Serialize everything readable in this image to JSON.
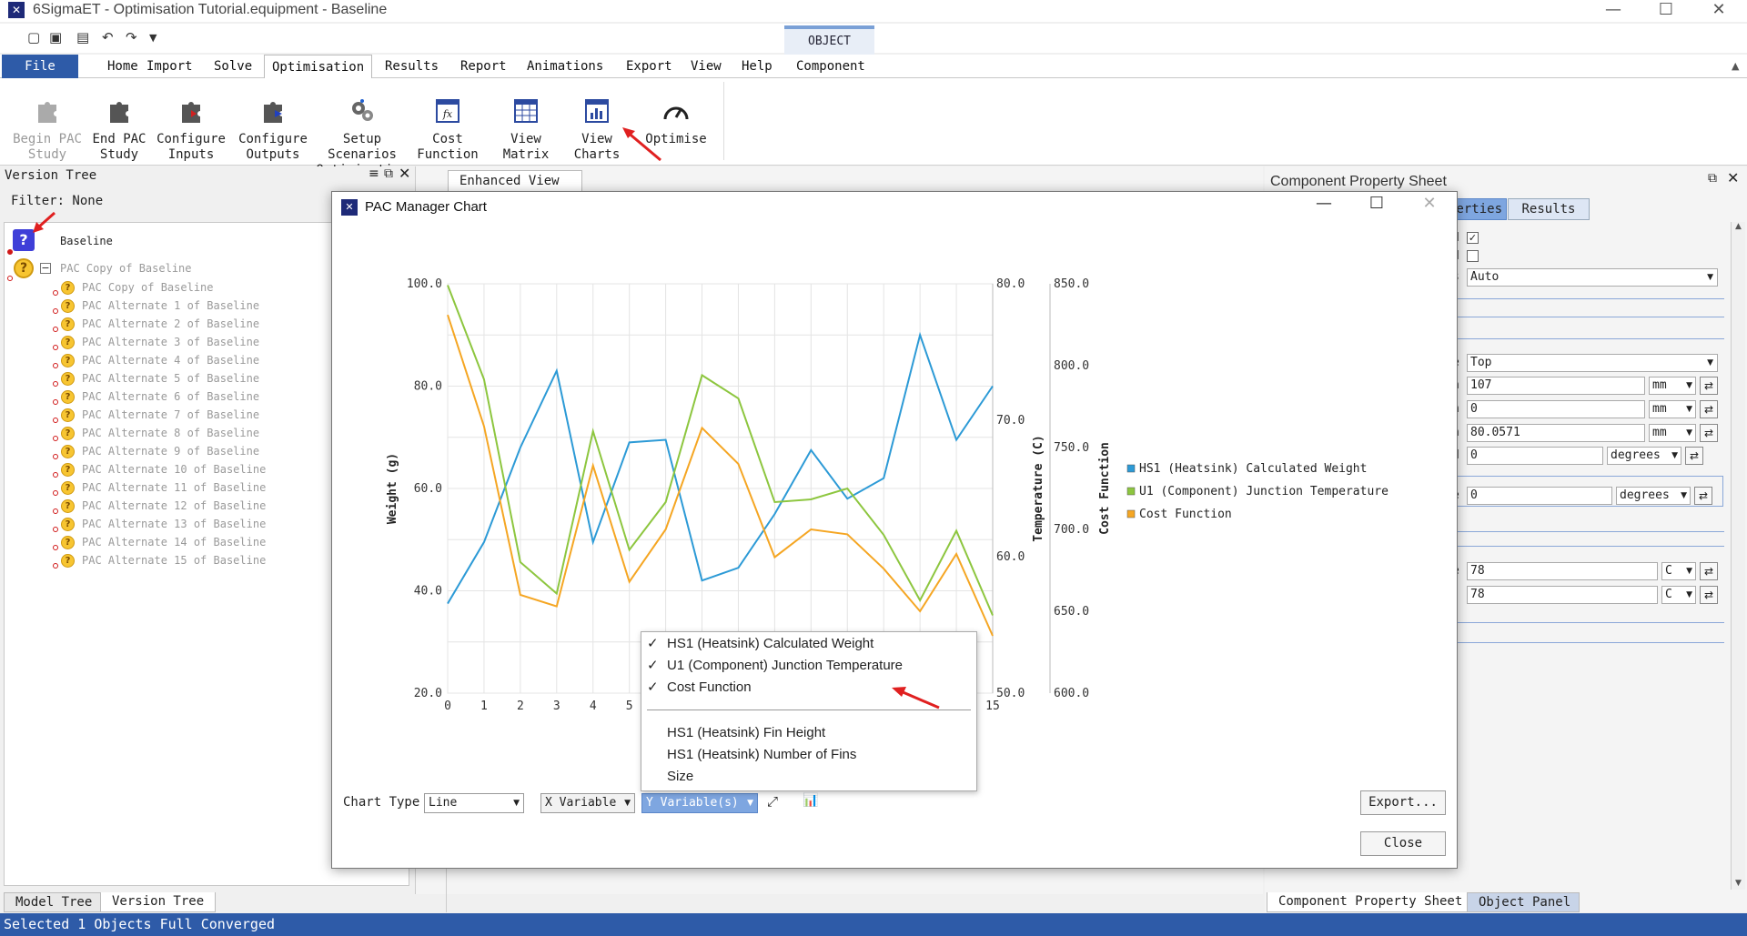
{
  "window": {
    "title": "6SigmaET - Optimisation Tutorial.equipment - Baseline",
    "minimize": "—",
    "maximize": "☐",
    "close": "✕"
  },
  "context_tab": {
    "group": "OBJECT",
    "label": "Component"
  },
  "menu": [
    "File",
    "Home",
    "Import",
    "Solve",
    "Optimisation",
    "Results",
    "Report",
    "Animations",
    "Export",
    "View",
    "Help"
  ],
  "ribbon": {
    "buttons": [
      {
        "label": "Begin PAC\nStudy",
        "icon": "puzzle-icon",
        "enabled": false
      },
      {
        "label": "End PAC\nStudy",
        "icon": "puzzle-icon",
        "enabled": true
      },
      {
        "label": "Configure\nInputs",
        "icon": "puzzle-input-icon",
        "enabled": true
      },
      {
        "label": "Configure\nOutputs",
        "icon": "puzzle-output-icon",
        "enabled": true
      },
      {
        "label": "Setup\nScenarios\nOptimisation",
        "icon": "gears-icon",
        "enabled": true
      },
      {
        "label": "Cost\nFunction",
        "icon": "fx-icon",
        "enabled": true
      },
      {
        "label": "View\nMatrix",
        "icon": "table-icon",
        "enabled": true
      },
      {
        "label": "View\nCharts",
        "icon": "bar-chart-icon",
        "enabled": true
      },
      {
        "label": "Optimise",
        "icon": "gauge-icon",
        "enabled": true
      }
    ]
  },
  "version_tree": {
    "title": "Version Tree",
    "filter": "Filter: None",
    "root": "Baseline",
    "copy_parent": "PAC Copy of Baseline",
    "items": [
      "PAC Copy of Baseline",
      "PAC Alternate 1 of Baseline",
      "PAC Alternate 2 of Baseline",
      "PAC Alternate 3 of Baseline",
      "PAC Alternate 4 of Baseline",
      "PAC Alternate 5 of Baseline",
      "PAC Alternate 6 of Baseline",
      "PAC Alternate 7 of Baseline",
      "PAC Alternate 8 of Baseline",
      "PAC Alternate 9 of Baseline",
      "PAC Alternate 10 of Baseline",
      "PAC Alternate 11 of Baseline",
      "PAC Alternate 12 of Baseline",
      "PAC Alternate 13 of Baseline",
      "PAC Alternate 14 of Baseline",
      "PAC Alternate 15 of Baseline"
    ]
  },
  "bottom_tabs_left": [
    "Model Tree",
    "Version Tree"
  ],
  "status": "Selected 1 Objects Full Converged",
  "center": {
    "tab": "Enhanced View"
  },
  "property_sheet": {
    "title": "Component Property Sheet",
    "tabs": [
      "erties",
      "Results"
    ],
    "rows": [
      {
        "label": "d",
        "type": "check",
        "checked": true
      },
      {
        "label": "d",
        "type": "check",
        "checked": false
      },
      {
        "label": "s",
        "type": "select",
        "value": "Auto"
      },
      {
        "label": "e",
        "type": "select",
        "value": "Top"
      },
      {
        "label": "n",
        "type": "unit",
        "value": "107",
        "unit": "mm"
      },
      {
        "label": "n",
        "type": "unit",
        "value": "0",
        "unit": "mm"
      },
      {
        "label": "n",
        "type": "unit",
        "value": "80.0571",
        "unit": "mm"
      },
      {
        "label": "d",
        "type": "unit",
        "value": "0",
        "unit": "degrees"
      },
      {
        "label": "e",
        "type": "unit",
        "value": "0",
        "unit": "degrees"
      },
      {
        "label": "e",
        "type": "unit",
        "value": "78",
        "unit": "C"
      },
      {
        "label": ":",
        "type": "unit",
        "value": "78",
        "unit": "C"
      }
    ],
    "bottom_tabs": [
      "Component Property Sheet",
      "Object Panel"
    ]
  },
  "dialog": {
    "title": "PAC Manager Chart",
    "chart_type_label": "Chart Type",
    "chart_type_value": "Line",
    "x_variable": "X Variable",
    "y_variable": "Y Variable(s)",
    "export_label": "Export...",
    "close_label": "Close",
    "dropdown": [
      {
        "label": "HS1 (Heatsink) Calculated Weight",
        "checked": true
      },
      {
        "label": "U1 (Component) Junction Temperature",
        "checked": true
      },
      {
        "label": "Cost Function",
        "checked": true
      },
      {
        "label": "HS1 (Heatsink) Fin Height",
        "checked": false
      },
      {
        "label": "HS1 (Heatsink) Number of Fins",
        "checked": false
      },
      {
        "label": "Size",
        "checked": false
      }
    ]
  },
  "chart_data": {
    "type": "line",
    "x": [
      0,
      1,
      2,
      3,
      4,
      5,
      6,
      7,
      8,
      9,
      10,
      11,
      12,
      13,
      14,
      15
    ],
    "xlim": [
      0,
      15
    ],
    "x_ticks": [
      "0",
      "1",
      "2",
      "3",
      "4",
      "5",
      "6",
      "7",
      "8",
      "9",
      "10",
      "11",
      "12",
      "13",
      "14",
      "15"
    ],
    "x_ticks_visible": [
      "0",
      "1",
      "2",
      "3",
      "4",
      "5",
      "15"
    ],
    "axes": [
      {
        "label": "Weight (g)",
        "ylim": [
          20,
          100
        ],
        "ticks": [
          "20.0",
          "40.0",
          "60.0",
          "80.0",
          "100.0"
        ],
        "color": "#2196d8"
      },
      {
        "label": "Temperature (C)",
        "ylim": [
          50,
          80
        ],
        "ticks": [
          "50.0",
          "60.0",
          "70.0",
          "80.0"
        ],
        "color": "#8dc63f"
      },
      {
        "label": "Cost Function",
        "ylim": [
          600,
          850
        ],
        "ticks": [
          "600.0",
          "650.0",
          "700.0",
          "750.0",
          "800.0",
          "850.0"
        ],
        "color": "#f5a623"
      }
    ],
    "series": [
      {
        "name": "HS1 (Heatsink) Calculated Weight",
        "axis": 0,
        "color": "#2c9ad6",
        "values": [
          37.5,
          49.5,
          68,
          83,
          49.5,
          69,
          69.5,
          42,
          44.5,
          55,
          67.5,
          58,
          62,
          90,
          69.5,
          80
        ]
      },
      {
        "name": "U1 (Component) Junction Temperature",
        "axis": 1,
        "color": "#8dc63f",
        "values": [
          79.9,
          73,
          59.6,
          57.3,
          69.2,
          60.5,
          64,
          73.3,
          71.6,
          64,
          64.2,
          65,
          61.6,
          56.8,
          61.9,
          55.7
        ]
      },
      {
        "name": "Cost Function",
        "axis": 2,
        "color": "#f5a623",
        "values": [
          831,
          763,
          660,
          653,
          739,
          668,
          700,
          762,
          740,
          683,
          700,
          697,
          676,
          650,
          685,
          635
        ]
      }
    ],
    "grid": true,
    "legend": "right"
  }
}
